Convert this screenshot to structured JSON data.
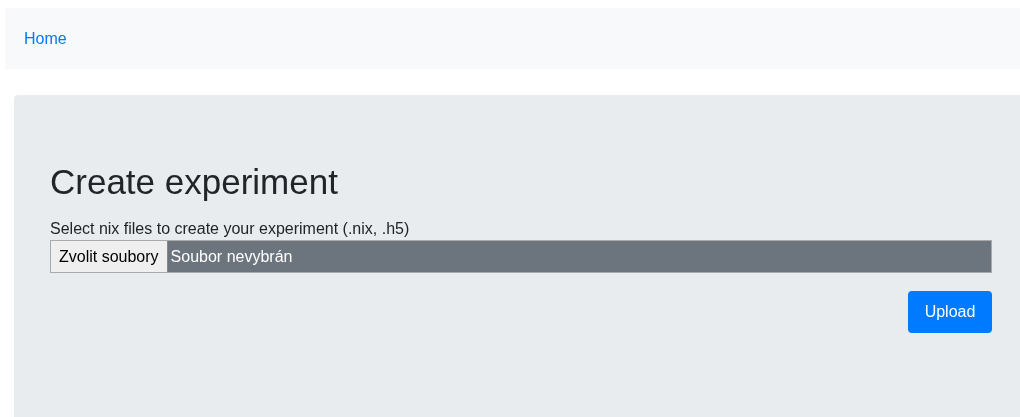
{
  "navbar": {
    "home_link": "Home"
  },
  "form": {
    "title": "Create experiment",
    "label": "Select nix files to create your experiment (.nix, .h5)",
    "file_input": {
      "button": "Zvolit soubory",
      "status": "Soubor nevybrán"
    },
    "submit": "Upload"
  }
}
